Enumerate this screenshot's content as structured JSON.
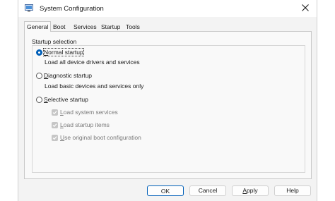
{
  "window": {
    "title": "System Configuration",
    "app_icon": "system-config-icon",
    "close_icon": "close-icon"
  },
  "tabs": [
    {
      "label": "General",
      "active": true
    },
    {
      "label": "Boot",
      "active": false
    },
    {
      "label": "Services",
      "active": false
    },
    {
      "label": "Startup",
      "active": false
    },
    {
      "label": "Tools",
      "active": false
    }
  ],
  "startup_selection": {
    "group_label": "Startup selection",
    "normal": {
      "label_first": "N",
      "label_rest": "ormal startup",
      "description": "Load all device drivers and services",
      "selected": true
    },
    "diagnostic": {
      "label_first": "D",
      "label_rest": "iagnostic startup",
      "description": "Load basic devices and services only",
      "selected": false
    },
    "selective": {
      "label_first": "S",
      "label_rest": "elective startup",
      "selected": false,
      "options": [
        {
          "label_first": "L",
          "label_rest": "oad system services",
          "checked": true,
          "enabled": false
        },
        {
          "label_first": "L",
          "label_rest": "oad startup items",
          "checked": true,
          "enabled": false
        },
        {
          "label_first": "U",
          "label_rest": "se original boot configuration",
          "checked": true,
          "enabled": false
        }
      ]
    }
  },
  "buttons": {
    "ok": "OK",
    "cancel": "Cancel",
    "apply_first": "A",
    "apply_rest": "pply",
    "help": "Help"
  },
  "colors": {
    "accent": "#005fb8",
    "disabled_text": "#7a7a7a"
  }
}
